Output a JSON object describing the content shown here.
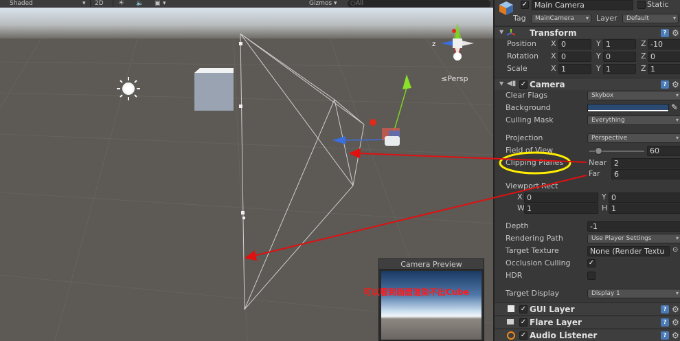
{
  "toolbar": {
    "shading_mode": "Shaded",
    "mode_2d": "2D",
    "gizmos": "Gizmos",
    "search_placeholder": "○All"
  },
  "scene": {
    "persp_label": "≤Persp",
    "gizmo_axes": {
      "z": "z",
      "x": "x"
    }
  },
  "preview": {
    "title": "Camera Preview"
  },
  "annotation": {
    "text": "可以看到画面渲染不出Cube"
  },
  "inspector": {
    "object_name": "Main Camera",
    "static_label": "Static",
    "tag_label": "Tag",
    "tag_value": "MainCamera",
    "layer_label": "Layer",
    "layer_value": "Default",
    "transform": {
      "title": "Transform",
      "position": {
        "label": "Position",
        "x": "0",
        "y": "1",
        "z": "-10"
      },
      "rotation": {
        "label": "Rotation",
        "x": "0",
        "y": "0",
        "z": "0"
      },
      "scale": {
        "label": "Scale",
        "x": "1",
        "y": "1",
        "z": "1"
      },
      "axis_x": "X",
      "axis_y": "Y",
      "axis_z": "Z"
    },
    "camera": {
      "title": "Camera",
      "clear_flags": {
        "label": "Clear Flags",
        "value": "Skybox"
      },
      "background": {
        "label": "Background",
        "color": "#2a4a72"
      },
      "culling_mask": {
        "label": "Culling Mask",
        "value": "Everything"
      },
      "projection": {
        "label": "Projection",
        "value": "Perspective"
      },
      "field_of_view": {
        "label": "Field of View",
        "value": "60",
        "slider_fraction": 0.167
      },
      "clipping_planes": {
        "label": "Clipping Planes",
        "near_label": "Near",
        "near": "2",
        "far_label": "Far",
        "far": "6"
      },
      "viewport_rect": {
        "label": "Viewport Rect",
        "x_label": "X",
        "x": "0",
        "y_label": "Y",
        "y": "0",
        "w_label": "W",
        "w": "1",
        "h_label": "H",
        "h": "1"
      },
      "depth": {
        "label": "Depth",
        "value": "-1"
      },
      "rendering_path": {
        "label": "Rendering Path",
        "value": "Use Player Settings"
      },
      "target_texture": {
        "label": "Target Texture",
        "value": "None (Render Textu"
      },
      "occlusion_culling": {
        "label": "Occlusion Culling",
        "checked": true
      },
      "hdr": {
        "label": "HDR",
        "checked": false
      },
      "target_display": {
        "label": "Target Display",
        "value": "Display 1"
      }
    },
    "components": [
      {
        "title": "GUI Layer"
      },
      {
        "title": "Flare Layer"
      },
      {
        "title": "Audio Listener"
      }
    ]
  },
  "colors": {
    "highlight_circle": "#ffee00",
    "annotation_arrow": "#e01010",
    "axis_x": "#d93a2a",
    "axis_y": "#7ed321",
    "axis_z": "#3a6fe0"
  }
}
